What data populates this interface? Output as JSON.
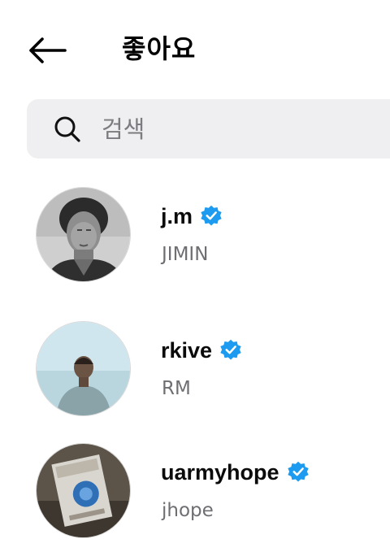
{
  "header": {
    "title": "좋아요"
  },
  "search": {
    "placeholder": "검색",
    "value": ""
  },
  "colors": {
    "verified": "#1d9bf0",
    "search_bg": "#efeff1",
    "secondary_text": "#6e6e73"
  },
  "icons": {
    "back": "arrow-left-icon",
    "search": "search-icon",
    "verified": "verified-badge-icon"
  },
  "likes": [
    {
      "username": "j.m",
      "fullname": "JIMIN",
      "verified": true
    },
    {
      "username": "rkive",
      "fullname": "RM",
      "verified": true
    },
    {
      "username": "uarmyhope",
      "fullname": "jhope",
      "verified": true
    }
  ]
}
